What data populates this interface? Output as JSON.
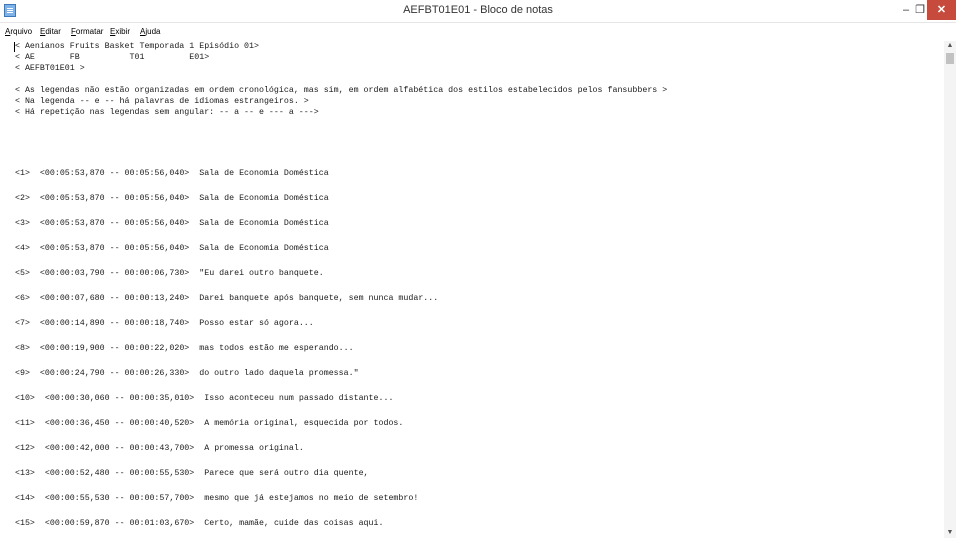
{
  "window": {
    "title": "AEFBT01E01 - Bloco de notas",
    "minimize_glyph": "–",
    "maximize_glyph": "❐",
    "close_glyph": "✕"
  },
  "menu": [
    "Arquivo",
    "Editar",
    "Formatar",
    "Exibir",
    "Ajuda"
  ],
  "header_lines": [
    "< Aenianos Fruits Basket Temporada 1 Episódio 01>",
    "< AE       FB          T01         E01>",
    "< AEFBT01E01 >",
    "",
    "< As legendas não estão organizadas em ordem cronológica, mas sim, em ordem alfabética dos estilos estabelecidos pelos fansubbers >",
    "< Na legenda -- e -- há palavras de idiomas estrangeiros. >",
    "< Há repetição nas legendas sem angular: -- a -- e --- a --->"
  ],
  "subtitles": [
    {
      "num": "<1>",
      "time": "<00:05:53,870 -- 00:05:56,040>",
      "text": "Sala de Economia Doméstica"
    },
    {
      "num": "<2>",
      "time": "<00:05:53,870 -- 00:05:56,040>",
      "text": "Sala de Economia Doméstica"
    },
    {
      "num": "<3>",
      "time": "<00:05:53,870 -- 00:05:56,040>",
      "text": "Sala de Economia Doméstica"
    },
    {
      "num": "<4>",
      "time": "<00:05:53,870 -- 00:05:56,040>",
      "text": "Sala de Economia Doméstica"
    },
    {
      "num": "<5>",
      "time": "<00:00:03,790 -- 00:00:06,730>",
      "text": "\"Eu darei outro banquete."
    },
    {
      "num": "<6>",
      "time": "<00:00:07,680 -- 00:00:13,240>",
      "text": "Darei banquete após banquete, sem nunca mudar..."
    },
    {
      "num": "<7>",
      "time": "<00:00:14,890 -- 00:00:18,740>",
      "text": "Posso estar só agora..."
    },
    {
      "num": "<8>",
      "time": "<00:00:19,900 -- 00:00:22,020>",
      "text": "mas todos estão me esperando..."
    },
    {
      "num": "<9>",
      "time": "<00:00:24,790 -- 00:00:26,330>",
      "text": "do outro lado daquela promessa.\""
    },
    {
      "num": "<10>",
      "time": "<00:00:30,060 -- 00:00:35,010>",
      "text": "Isso aconteceu num passado distante..."
    },
    {
      "num": "<11>",
      "time": "<00:00:36,450 -- 00:00:40,520>",
      "text": "A memória original, esquecida por todos."
    },
    {
      "num": "<12>",
      "time": "<00:00:42,000 -- 00:00:43,700>",
      "text": "A promessa original."
    },
    {
      "num": "<13>",
      "time": "<00:00:52,480 -- 00:00:55,530>",
      "text": "Parece que será outro dia quente,"
    },
    {
      "num": "<14>",
      "time": "<00:00:55,530 -- 00:00:57,700>",
      "text": "mesmo que já estejamos no meio de setembro!"
    },
    {
      "num": "<15>",
      "time": "<00:00:59,870 -- 00:01:03,670>",
      "text": "Certo, mamãe, cuide das coisas aqui."
    }
  ],
  "scrollbar": {
    "up_glyph": "▲",
    "down_glyph": "▼"
  },
  "colors": {
    "close_button": "#c74b3d",
    "app_icon": "#7fb2e6"
  }
}
